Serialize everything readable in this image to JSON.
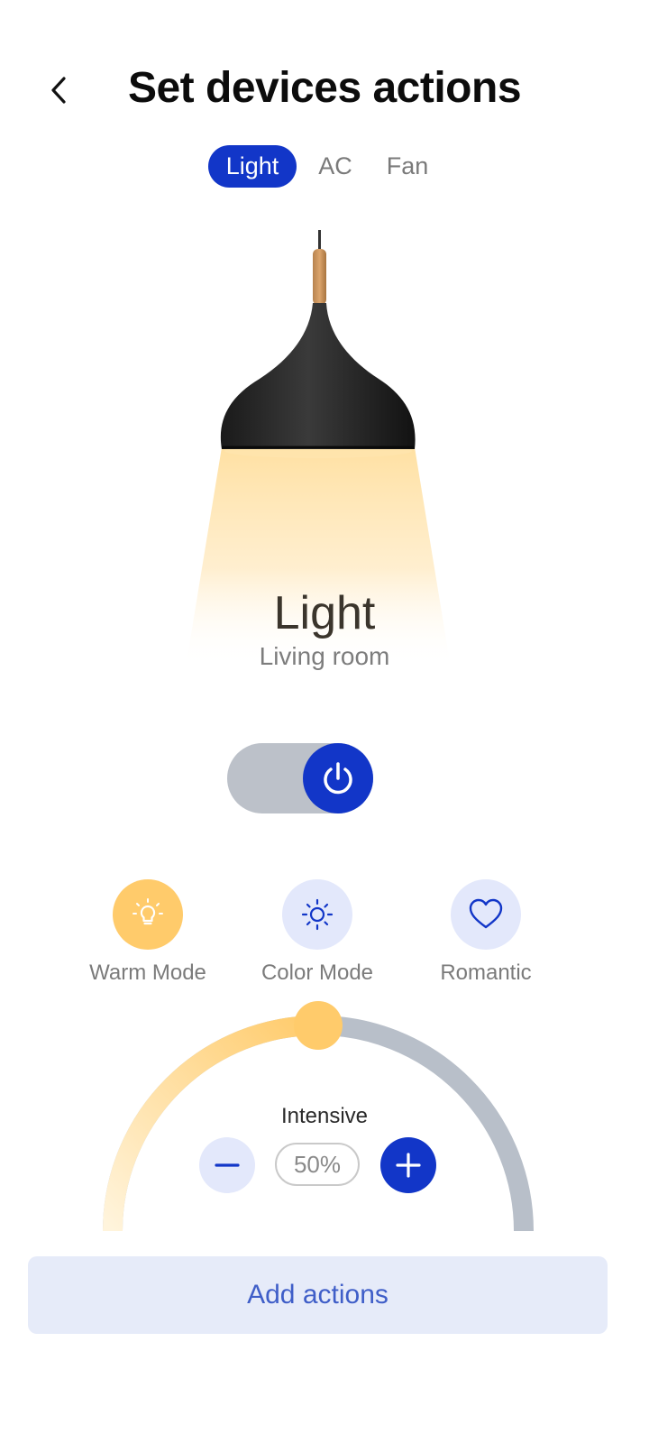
{
  "header": {
    "title": "Set devices actions"
  },
  "tabs": [
    {
      "label": "Light",
      "active": true
    },
    {
      "label": "AC",
      "active": false
    },
    {
      "label": "Fan",
      "active": false
    }
  ],
  "device": {
    "name": "Light",
    "room": "Living room",
    "power": "on"
  },
  "modes": [
    {
      "label": "Warm Mode",
      "icon": "lightbulb-icon",
      "active": true
    },
    {
      "label": "Color Mode",
      "icon": "sun-icon",
      "active": false
    },
    {
      "label": "Romantic",
      "icon": "heart-icon",
      "active": false
    }
  ],
  "intensity": {
    "label": "Intensive",
    "value_text": "50%",
    "value": 0.5
  },
  "actions": {
    "add_label": "Add actions"
  },
  "colors": {
    "primary": "#1236c8",
    "warm": "#ffcb6b",
    "track": "#b8bfc9",
    "button_bg": "#e6ebf9"
  }
}
